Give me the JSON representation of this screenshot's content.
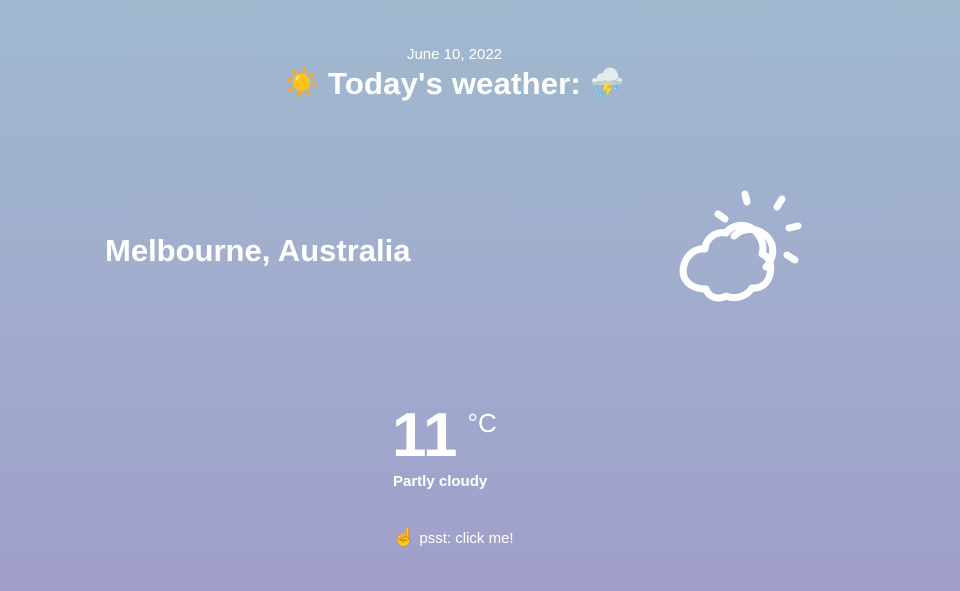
{
  "header": {
    "date": "June 10, 2022",
    "title_prefix_icon": "☀️",
    "title": "Today's weather:",
    "title_suffix_icon": "⛈️"
  },
  "location": {
    "city": "Melbourne, Australia"
  },
  "current": {
    "temperature": "11",
    "unit": "°C",
    "condition": "Partly cloudy",
    "icon": "partly-cloudy-icon"
  },
  "hint": {
    "icon": "☝️",
    "text": "psst: click me!"
  },
  "colors": {
    "background_top": "#9fb9cf",
    "background_bottom": "#a09fcb",
    "text": "#ffffff"
  }
}
